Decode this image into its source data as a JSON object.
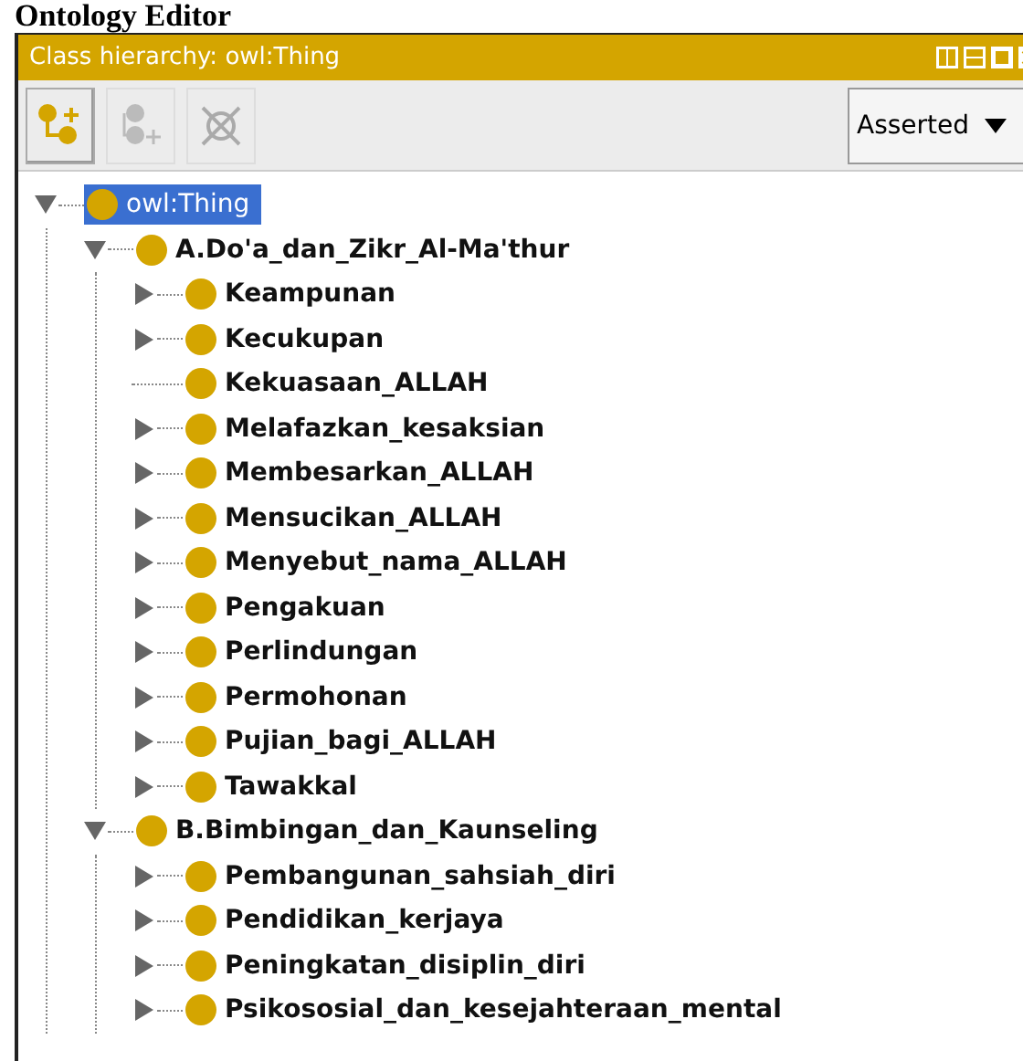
{
  "page_heading": "Ontology Editor",
  "panel": {
    "title": "Class hierarchy: owl:Thing"
  },
  "toolbar": {
    "buttons": [
      {
        "kind": "add_subclass",
        "disabled": false
      },
      {
        "kind": "add_sibling",
        "disabled": true
      },
      {
        "kind": "delete",
        "disabled": true
      }
    ],
    "view_select": {
      "value": "Asserted"
    }
  },
  "tree": [
    {
      "label": "owl:Thing",
      "selected": true,
      "kind": "branch",
      "expanded": true,
      "children": [
        {
          "label": "A.Do'a_dan_Zikr_Al-Ma'thur",
          "selected": false,
          "kind": "branch",
          "expanded": true,
          "children": [
            {
              "label": "Keampunan",
              "selected": false,
              "kind": "branch",
              "expanded": false
            },
            {
              "label": "Kecukupan",
              "selected": false,
              "kind": "branch",
              "expanded": false
            },
            {
              "label": "Kekuasaan_ALLAH",
              "selected": false,
              "kind": "leaf"
            },
            {
              "label": "Melafazkan_kesaksian",
              "selected": false,
              "kind": "branch",
              "expanded": false
            },
            {
              "label": "Membesarkan_ALLAH",
              "selected": false,
              "kind": "branch",
              "expanded": false
            },
            {
              "label": "Mensucikan_ALLAH",
              "selected": false,
              "kind": "branch",
              "expanded": false
            },
            {
              "label": "Menyebut_nama_ALLAH",
              "selected": false,
              "kind": "branch",
              "expanded": false
            },
            {
              "label": "Pengakuan",
              "selected": false,
              "kind": "branch",
              "expanded": false
            },
            {
              "label": "Perlindungan",
              "selected": false,
              "kind": "branch",
              "expanded": false
            },
            {
              "label": "Permohonan",
              "selected": false,
              "kind": "branch",
              "expanded": false
            },
            {
              "label": "Pujian_bagi_ALLAH",
              "selected": false,
              "kind": "branch",
              "expanded": false
            },
            {
              "label": "Tawakkal",
              "selected": false,
              "kind": "branch",
              "expanded": false
            }
          ]
        },
        {
          "label": "B.Bimbingan_dan_Kaunseling",
          "selected": false,
          "kind": "branch",
          "expanded": true,
          "children": [
            {
              "label": "Pembangunan_sahsiah_diri",
              "selected": false,
              "kind": "branch",
              "expanded": false
            },
            {
              "label": "Pendidikan_kerjaya",
              "selected": false,
              "kind": "branch",
              "expanded": false
            },
            {
              "label": "Peningkatan_disiplin_diri",
              "selected": false,
              "kind": "branch",
              "expanded": false
            },
            {
              "label": "Psikososial_dan_kesejahteraan_mental",
              "selected": false,
              "kind": "branch",
              "expanded": false
            }
          ]
        }
      ]
    }
  ]
}
